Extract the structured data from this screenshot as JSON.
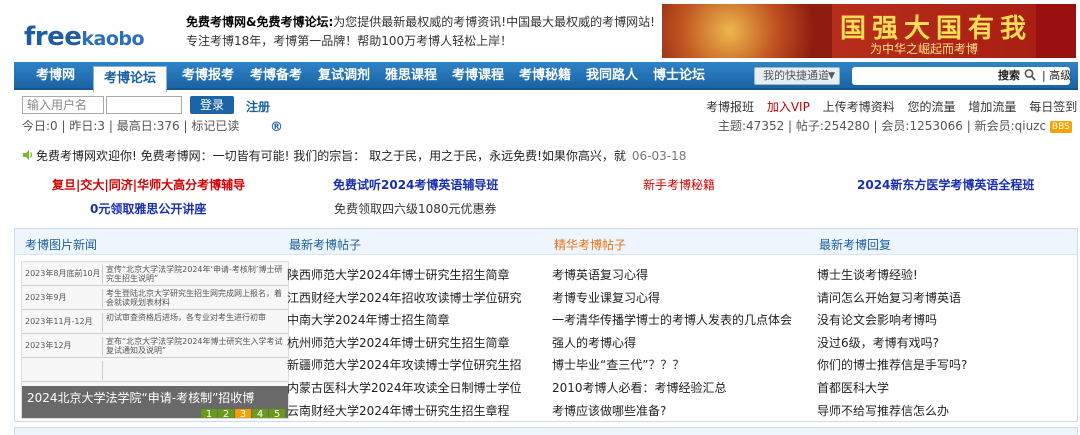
{
  "header": {
    "logo_free": "free",
    "logo_kaobo": "kaobo",
    "logo_reg": "®",
    "tagline_bold": "免费考博网&免费考博论坛:",
    "tagline_rest": "为您提供最新最权威的考博资讯!中国最大最权威的考博网站!",
    "tagline2": "专注考博18年，考博第一品牌！帮助100万考博人轻松上岸！",
    "banner_slogan": "国强大国有我",
    "banner_sub": "为中华之崛起而考博"
  },
  "nav": {
    "items": [
      "考博网",
      "考博论坛",
      "考博报考",
      "考博备考",
      "复试调剂",
      "雅思课程",
      "考博课程",
      "考博秘籍",
      "我同路人",
      "博士论坛"
    ],
    "active_index": 1,
    "quick_nav": "我的快捷通道",
    "search_label": "搜索",
    "advanced_label": "高级"
  },
  "login": {
    "username_placeholder": "输入用户名",
    "login_button": "登录",
    "register": "注册"
  },
  "stats_left": "今日:0 | 昨日:3 | 最高日:376 | 标记已读",
  "top_links": {
    "l1": "考博报班",
    "l2": "加入VIP",
    "l3": "上传考博资料",
    "l4": "您的流量",
    "l5": "增加流量",
    "l6": "每日签到"
  },
  "stats_right": "主题:47352 | 帖子:254280 | 会员:1253066 | 新会员:qiuzc",
  "bbs_badge": "BBS",
  "announcement": {
    "text": "免费考博网欢迎你! 免费考博网：一切皆有可能! 我们的宗旨： 取之于民，用之于民，永远免费!如果你高兴，就",
    "date": "06-03-18"
  },
  "promos": {
    "p1": "复旦|交大|同济|华师大高分考博辅导",
    "p2": "免费试听2024考博英语辅导班",
    "p3": "新手考博秘籍",
    "p4": "2024新东方医学考博英语全程班",
    "p5": "0元领取雅思公开讲座",
    "p6": "免费领取四六级1080元优惠券"
  },
  "panel": {
    "head_news": "考博图片新闻",
    "head_latest": "最新考博帖子",
    "head_elite": "精华考博帖子",
    "head_reply": "最新考博回复",
    "slide_rows": [
      {
        "c1": "2023年8月底前10月初",
        "c2": "宣传“北京大学法学院2024年‘申请-考核制’博士研究生招生说明”"
      },
      {
        "c1": "2023年9月",
        "c2": "考生登陆北京大学研究生招生网完成网上报名，着会就读规划表材料"
      },
      {
        "c1": "2023年11月-12月",
        "c2": "初试审查资格后进场，各专业对考生进行初审"
      },
      {
        "c1": "2023年12月",
        "c2": "宣布“北京大学法学院2024年博士研究生入学考试复试通知及说明”"
      },
      {
        "c1": "",
        "c2": ""
      }
    ],
    "slide_caption": "2024北京大学法学院“申请-考核制”招收博",
    "pager": [
      "1",
      "2",
      "3",
      "4",
      "5"
    ],
    "pager_active": 2,
    "latest": [
      "陕西师范大学2024年博士研究生招生简章",
      "江西财经大学2024年招收攻读博士学位研究",
      "中南大学2024年博士招生简章",
      "杭州师范大学2024年博士研究生招生简章",
      "新疆师范大学2024年攻读博士学位研究生招",
      "内蒙古医科大学2024年攻读全日制博士学位",
      "云南财经大学2024年博士研究生招生章程"
    ],
    "elite": [
      "考博英语复习心得",
      "考博专业课复习心得",
      "一考清华传播学博士的考博人发表的几点体会",
      "强人的考博心得",
      "博士毕业“查三代”？？？",
      "2010考博人必看：考博经验汇总",
      "考博应该做哪些准备?"
    ],
    "reply": [
      "博士生谈考博经验!",
      "请问怎么开始复习考博英语",
      "没有论文会影响考博吗",
      "没过6级，考博有戏吗?",
      "你们的博士推荐信是手写吗?",
      "首都医科大学",
      "导师不给写推荐信怎么办"
    ]
  },
  "colors": {
    "nav_blue": "#1b63a4",
    "vip_red": "#c40000",
    "elite_orange": "#e8731a",
    "promo_red": "#d40000",
    "promo_blue": "#1a2fb0"
  }
}
